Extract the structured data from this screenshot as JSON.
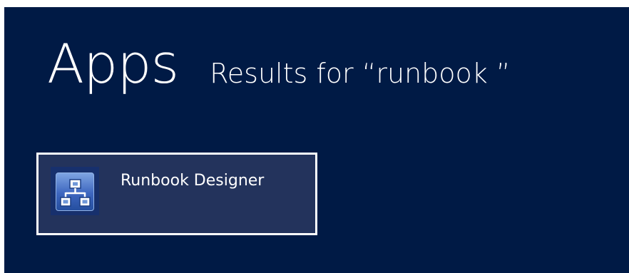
{
  "header": {
    "title": "Apps",
    "results_text": "Results for “runbook ”"
  },
  "results": [
    {
      "label": "Runbook Designer",
      "icon": "runbook-designer-icon"
    }
  ],
  "colors": {
    "background": "#001a45",
    "tile_background": "#23335c",
    "tile_border": "#ffffff",
    "text": "#ffffff"
  }
}
